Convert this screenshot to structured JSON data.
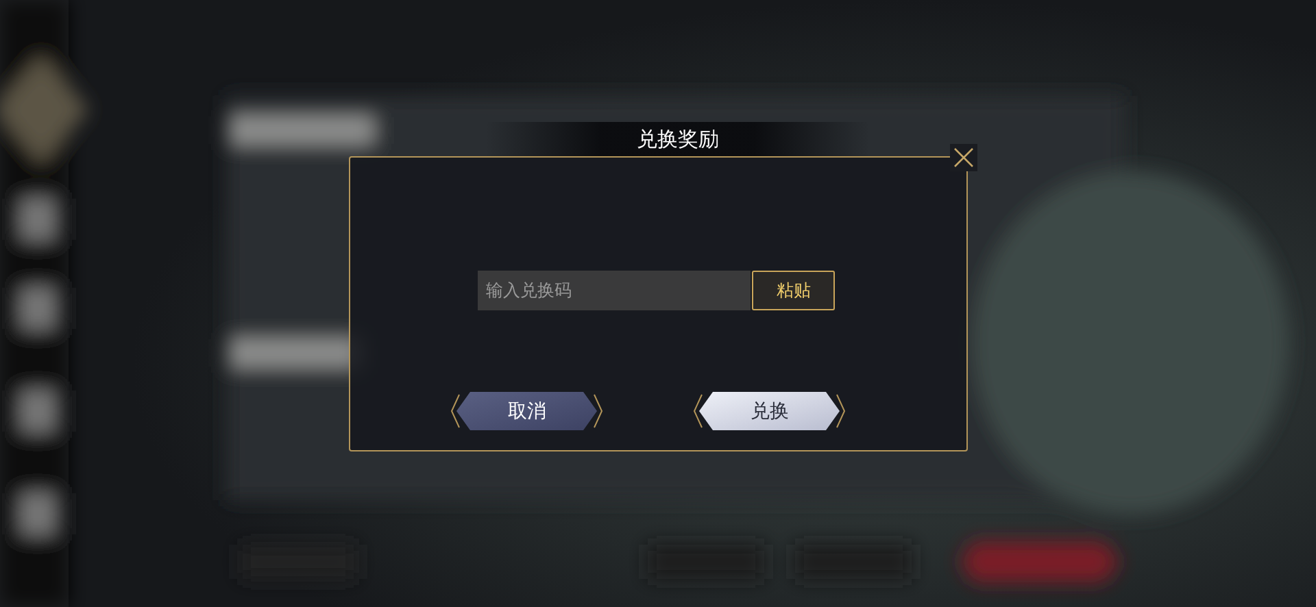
{
  "dialog": {
    "title": "兑换奖励",
    "code_field": {
      "placeholder": "输入兑换码"
    },
    "paste_button": "粘贴",
    "buttons": [
      {
        "label": "取消",
        "kind": "secondary"
      },
      {
        "label": "兑换",
        "kind": "primary"
      }
    ]
  }
}
